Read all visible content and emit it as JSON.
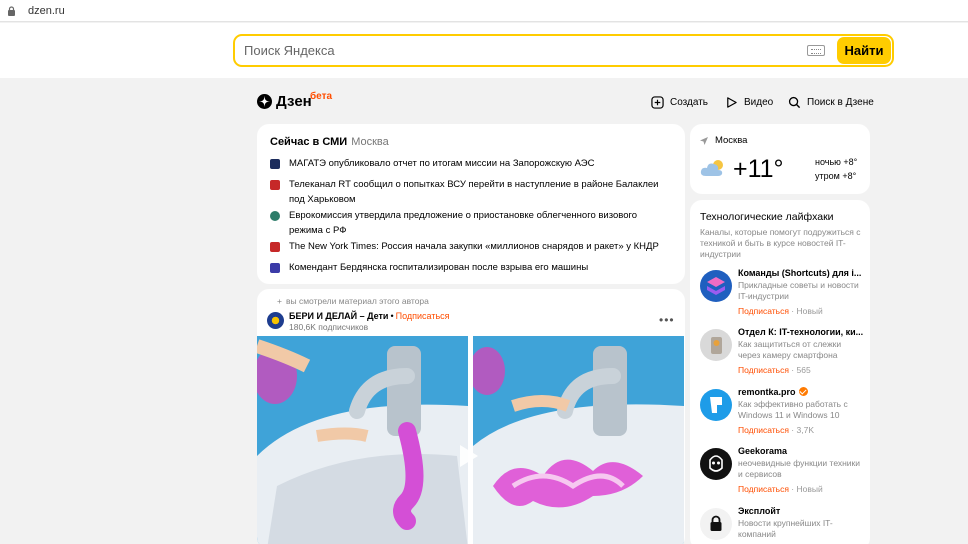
{
  "browser": {
    "url": "dzen.ru"
  },
  "search": {
    "placeholder": "Поиск Яндекса",
    "button_label": "Найти"
  },
  "header": {
    "logo_text": "Дзен",
    "logo_badge": "бета",
    "create_label": "Создать",
    "video_label": "Видео",
    "search_label": "Поиск в Дзене"
  },
  "news": {
    "title": "Сейчас в СМИ",
    "region": "Москва",
    "items": [
      {
        "text": "МАГАТЭ опубликовало отчет по итогам миссии на Запорожскую АЭС",
        "icon_color": "#1b2c5c"
      },
      {
        "text": "Телеканал RT сообщил о попытках ВСУ перейти в наступление в районе Балаклеи под Харьковом",
        "icon_color": "#c62828"
      },
      {
        "text": "Еврокомиссия утвердила предложение о приостановке облегченного визового режима с РФ",
        "icon_color": "#2e7d6a"
      },
      {
        "text": "The New York Times: Россия начала закупки «миллионов снарядов и ракет» у КНДР",
        "icon_color": "#c62828"
      },
      {
        "text": "Комендант Бердянска госпитализирован после взрыва его машины",
        "icon_color": "#3b3ba8"
      }
    ]
  },
  "feed": {
    "viewed_note": "вы смотрели материал этого автора",
    "channel_name": "БЕРИ И ДЕЛАЙ – Дети",
    "subscribe_label": "Подписаться",
    "subscribers": "180,6K подписчиков"
  },
  "weather": {
    "city": "Москва",
    "temperature": "+11°",
    "night": "ночью +8°",
    "morning": "утром +8°"
  },
  "tech": {
    "title": "Технологические лайфхаки",
    "description": "Каналы, которые помогут подружиться с техникой и быть в курсе новостей IT-индустрии",
    "channels": [
      {
        "name": "Команды (Shortcuts) для i...",
        "desc": "Прикладные советы и новости IT-индустрии",
        "subscribe": "Подписаться",
        "meta": "Новый"
      },
      {
        "name": "Отдел К: IT-технологии, ки...",
        "desc": "Как защититься от слежки через камеру смартфона",
        "subscribe": "Подписаться",
        "meta": "565"
      },
      {
        "name": "remontka.pro",
        "desc": "Как эффективно работать с Windows 11 и Windows 10",
        "subscribe": "Подписаться",
        "meta": "3,7K"
      },
      {
        "name": "Geekorama",
        "desc": "неочевидные функции техники и сервисов",
        "subscribe": "Подписаться",
        "meta": "Новый"
      },
      {
        "name": "Эксплойт",
        "desc": "Новости крупнейших IT-компаний",
        "subscribe": "",
        "meta": ""
      }
    ]
  },
  "colors": {
    "accent_yellow": "#ffcc00",
    "brand_orange": "#ff4d00"
  }
}
